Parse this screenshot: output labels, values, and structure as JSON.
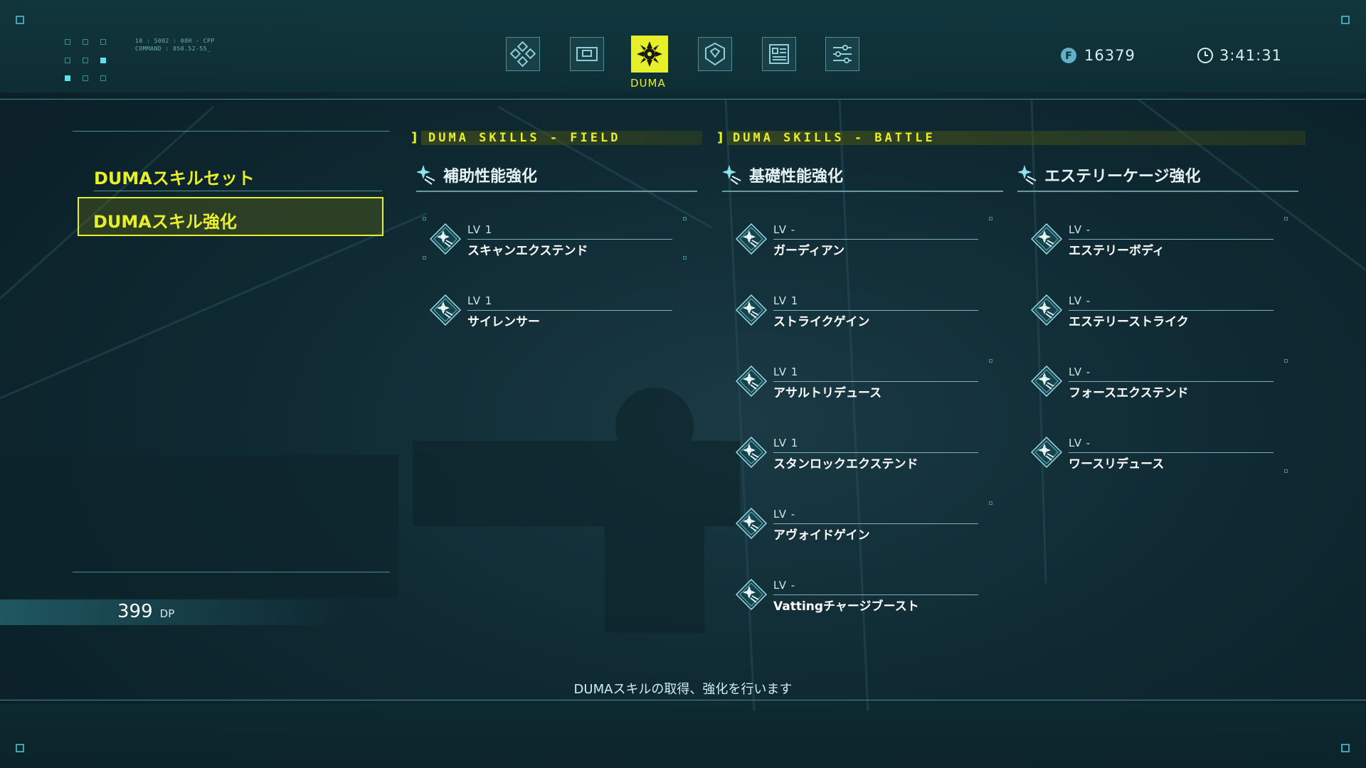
{
  "top_nav": {
    "tabs": [
      {
        "icon": "dpad-icon",
        "active": false
      },
      {
        "icon": "storage-icon",
        "active": false
      },
      {
        "icon": "duma-emblem-icon",
        "active": true,
        "label": "DUMA"
      },
      {
        "icon": "emblem-shield-icon",
        "active": false
      },
      {
        "icon": "data-file-icon",
        "active": false
      },
      {
        "icon": "settings-list-icon",
        "active": false
      }
    ]
  },
  "system_text": {
    "line1": "10 : 5002 : 00H - CPP",
    "line2": "COMMAND : 050.52-55_"
  },
  "hud": {
    "currency": "16379",
    "play_time": "3:41:31"
  },
  "left_menu": {
    "items": [
      {
        "label": "DUMAスキルセット",
        "selected": false
      },
      {
        "label": "DUMAスキル強化",
        "selected": true
      }
    ],
    "dp_value": "399",
    "dp_unit": "DP"
  },
  "banners": {
    "field": "DUMA SKILLS - FIELD",
    "battle": "DUMA SKILLS - BATTLE"
  },
  "categories": [
    {
      "title": "補助性能強化",
      "skills": [
        {
          "lv": "LV 1",
          "name": "スキャンエクステンド"
        },
        {
          "lv": "LV 1",
          "name": "サイレンサー"
        }
      ]
    },
    {
      "title": "基礎性能強化",
      "skills": [
        {
          "lv": "LV -",
          "name": "ガーディアン"
        },
        {
          "lv": "LV 1",
          "name": "ストライクゲイン"
        },
        {
          "lv": "LV 1",
          "name": "アサルトリデュース"
        },
        {
          "lv": "LV 1",
          "name": "スタンロックエクステンド"
        },
        {
          "lv": "LV -",
          "name": "アヴォイドゲイン"
        },
        {
          "lv": "LV -",
          "name": "Vattingチャージブースト"
        }
      ]
    },
    {
      "title": "エステリーケージ強化",
      "skills": [
        {
          "lv": "LV -",
          "name": "エステリーボディ"
        },
        {
          "lv": "LV -",
          "name": "エステリーストライク"
        },
        {
          "lv": "LV -",
          "name": "フォースエクステンド"
        },
        {
          "lv": "LV -",
          "name": "ワースリデュース"
        }
      ]
    }
  ],
  "footer_hint": "DUMAスキルの取得、強化を行います",
  "colors": {
    "accent": "#e6ef2a",
    "cyan": "#5fe0f0",
    "bg": "#0f2a33"
  }
}
